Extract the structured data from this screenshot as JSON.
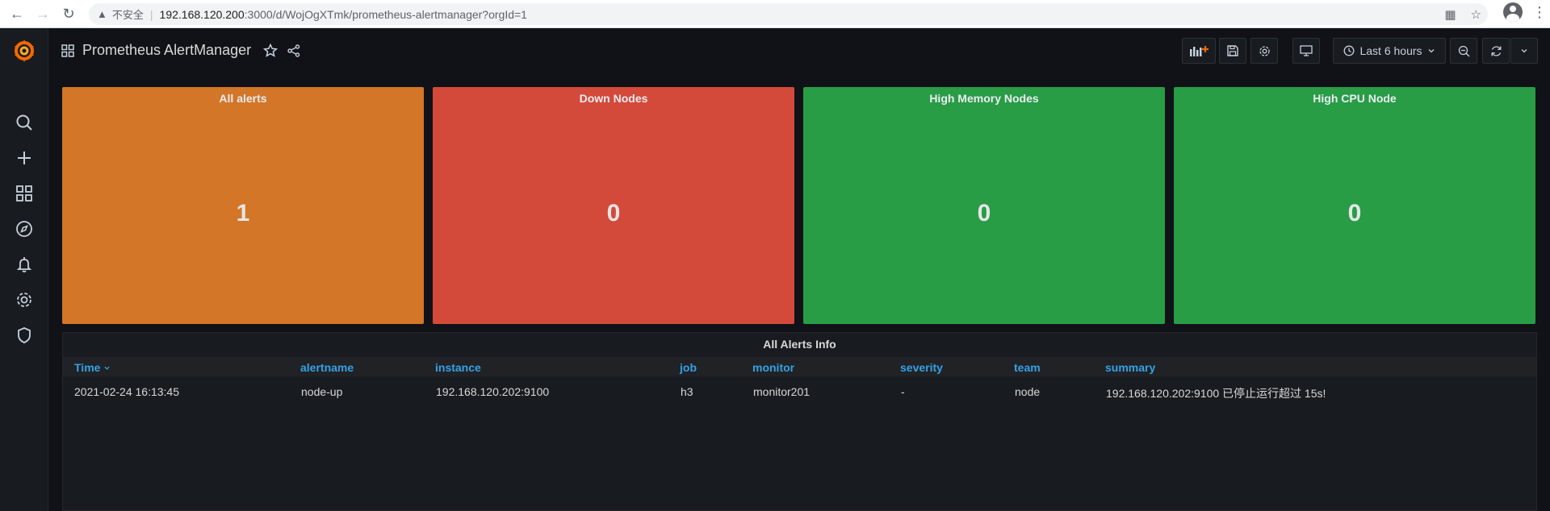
{
  "browser": {
    "insecure_label": "不安全",
    "url_host": "192.168.120.200",
    "url_path": ":3000/d/WojOgXTmk/prometheus-alertmanager?orgId=1"
  },
  "dashboard": {
    "title": "Prometheus AlertManager",
    "time_range": "Last 6 hours"
  },
  "stats": [
    {
      "title": "All alerts",
      "value": "1",
      "color": "#d37628"
    },
    {
      "title": "Down Nodes",
      "value": "0",
      "color": "#d44a3a"
    },
    {
      "title": "High Memory Nodes",
      "value": "0",
      "color": "#299c46"
    },
    {
      "title": "High CPU Node",
      "value": "0",
      "color": "#299c46"
    }
  ],
  "table": {
    "title": "All Alerts Info",
    "columns": [
      "Time",
      "alertname",
      "instance",
      "job",
      "monitor",
      "severity",
      "team",
      "summary"
    ],
    "rows": [
      [
        "2021-02-24 16:13:45",
        "node-up",
        "192.168.120.202:9100",
        "h3",
        "monitor201",
        "-",
        "node",
        "192.168.120.202:9100 已停止运行超过 15s!"
      ]
    ]
  }
}
